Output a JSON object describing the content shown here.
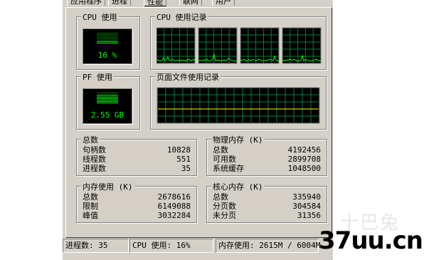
{
  "tabs": [
    "应用程序",
    "进程",
    "性能",
    "联网",
    "用户"
  ],
  "cpu_usage": {
    "title": "CPU 使用",
    "value": "16 %"
  },
  "cpu_history": {
    "title": "CPU 使用记录",
    "cores": 4
  },
  "pf_usage": {
    "title": "PF 使用",
    "value": "2.55 GB"
  },
  "pf_history": {
    "title": "页面文件使用记录"
  },
  "totals": {
    "title": "总数",
    "rows": [
      {
        "label": "句柄数",
        "value": "10828"
      },
      {
        "label": "线程数",
        "value": "551"
      },
      {
        "label": "进程数",
        "value": "35"
      }
    ]
  },
  "physical": {
    "title": "物理内存 (K)",
    "rows": [
      {
        "label": "总数",
        "value": "4192456"
      },
      {
        "label": "可用数",
        "value": "2899708"
      },
      {
        "label": "系统缓存",
        "value": "1048500"
      }
    ]
  },
  "commit": {
    "title": "内存使用 (K)",
    "rows": [
      {
        "label": "总数",
        "value": "2678616"
      },
      {
        "label": "限制",
        "value": "6149088"
      },
      {
        "label": "峰值",
        "value": "3032284"
      }
    ]
  },
  "kernel": {
    "title": "核心内存 (K)",
    "rows": [
      {
        "label": "总数",
        "value": "335940"
      },
      {
        "label": "分页数",
        "value": "304584"
      },
      {
        "label": "未分页",
        "value": "31356"
      }
    ]
  },
  "status": {
    "processes": "进程数: 35",
    "cpu": "CPU 使用: 16%",
    "memory": "内存使用: 2615M / 6004M"
  },
  "watermark": {
    "brand": "37uu.cn",
    "faint": "十巴兔"
  }
}
